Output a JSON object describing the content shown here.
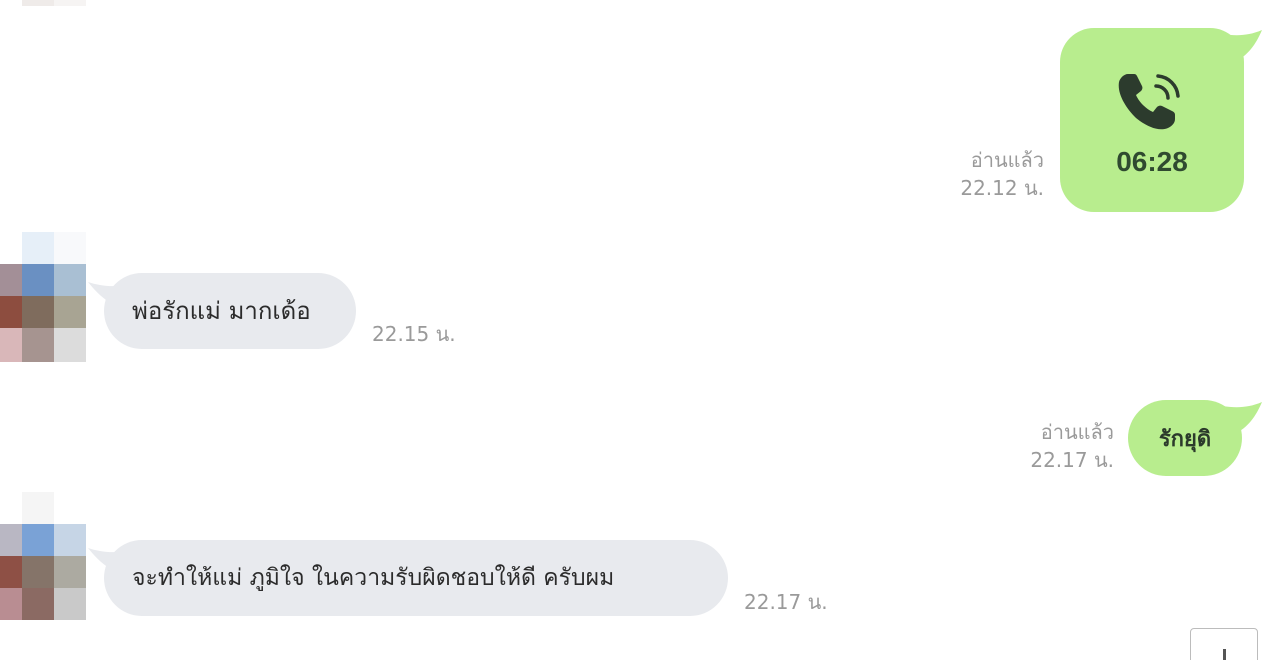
{
  "messages": [
    {
      "direction": "outgoing",
      "type": "call",
      "icon": "phone-ringing-icon",
      "duration": "06:28",
      "status": "อ่านแล้ว",
      "time": "22.12 น."
    },
    {
      "direction": "incoming",
      "type": "text",
      "text": "พ่อรักแม่ มากเด้อ",
      "time": "22.15 น."
    },
    {
      "direction": "outgoing",
      "type": "text",
      "text": "รักยุดิ",
      "status": "อ่านแล้ว",
      "time": "22.17 น."
    },
    {
      "direction": "incoming",
      "type": "text",
      "text": "จะทำให้แม่ ภูมิใจ  ในความรับผิดชอบให้ดี ครับผม",
      "time": "22.17 น."
    }
  ],
  "colors": {
    "outgoing_bubble": "#b8ed8e",
    "incoming_bubble": "#e8eaee",
    "meta_text": "#9a9a9a",
    "call_icon": "#2c3b2d"
  },
  "avatar_icon": "blurred-avatar"
}
